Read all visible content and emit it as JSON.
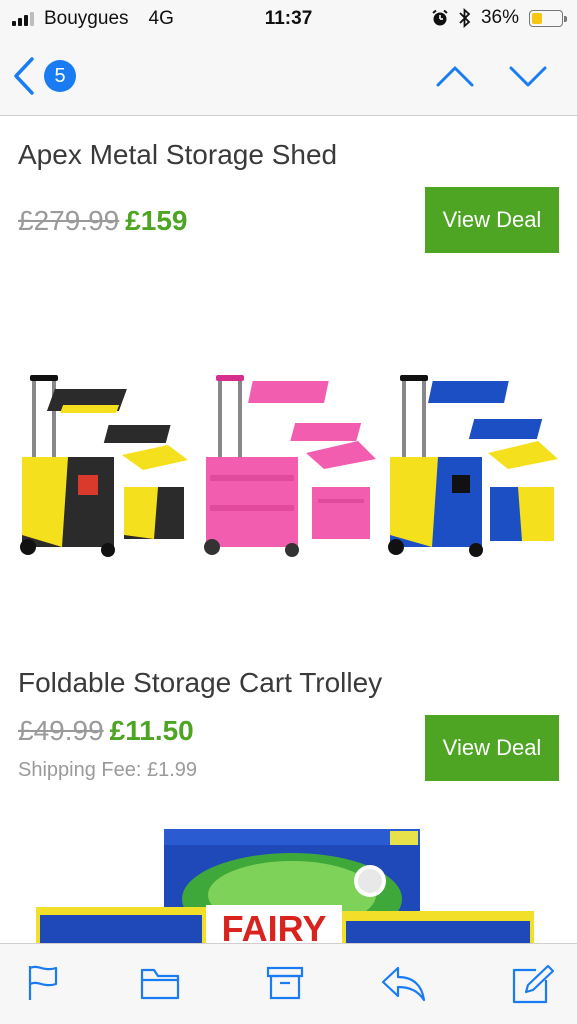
{
  "status_bar": {
    "carrier": "Bouygues",
    "network": "4G",
    "time": "11:37",
    "battery_percent": "36%",
    "battery_level": 0.36,
    "signal_bars": 3
  },
  "nav": {
    "back_count": "5"
  },
  "deals": [
    {
      "title": "Apex Metal Storage Shed",
      "old_price": "£279.99",
      "new_price": "£159",
      "button_label": "View Deal"
    },
    {
      "title": "Foldable Storage Cart Trolley",
      "old_price": "£49.99",
      "new_price": "£11.50",
      "shipping": "Shipping Fee: £1.99",
      "button_label": "View Deal"
    }
  ],
  "detergent": {
    "brand_text": "FAIRY"
  },
  "colors": {
    "accent_green": "#4ea423",
    "ios_blue": "#1a7cf2",
    "cart_yellow": "#f4e01c",
    "cart_pink": "#f25db0",
    "cart_blue": "#1d4fc4"
  }
}
